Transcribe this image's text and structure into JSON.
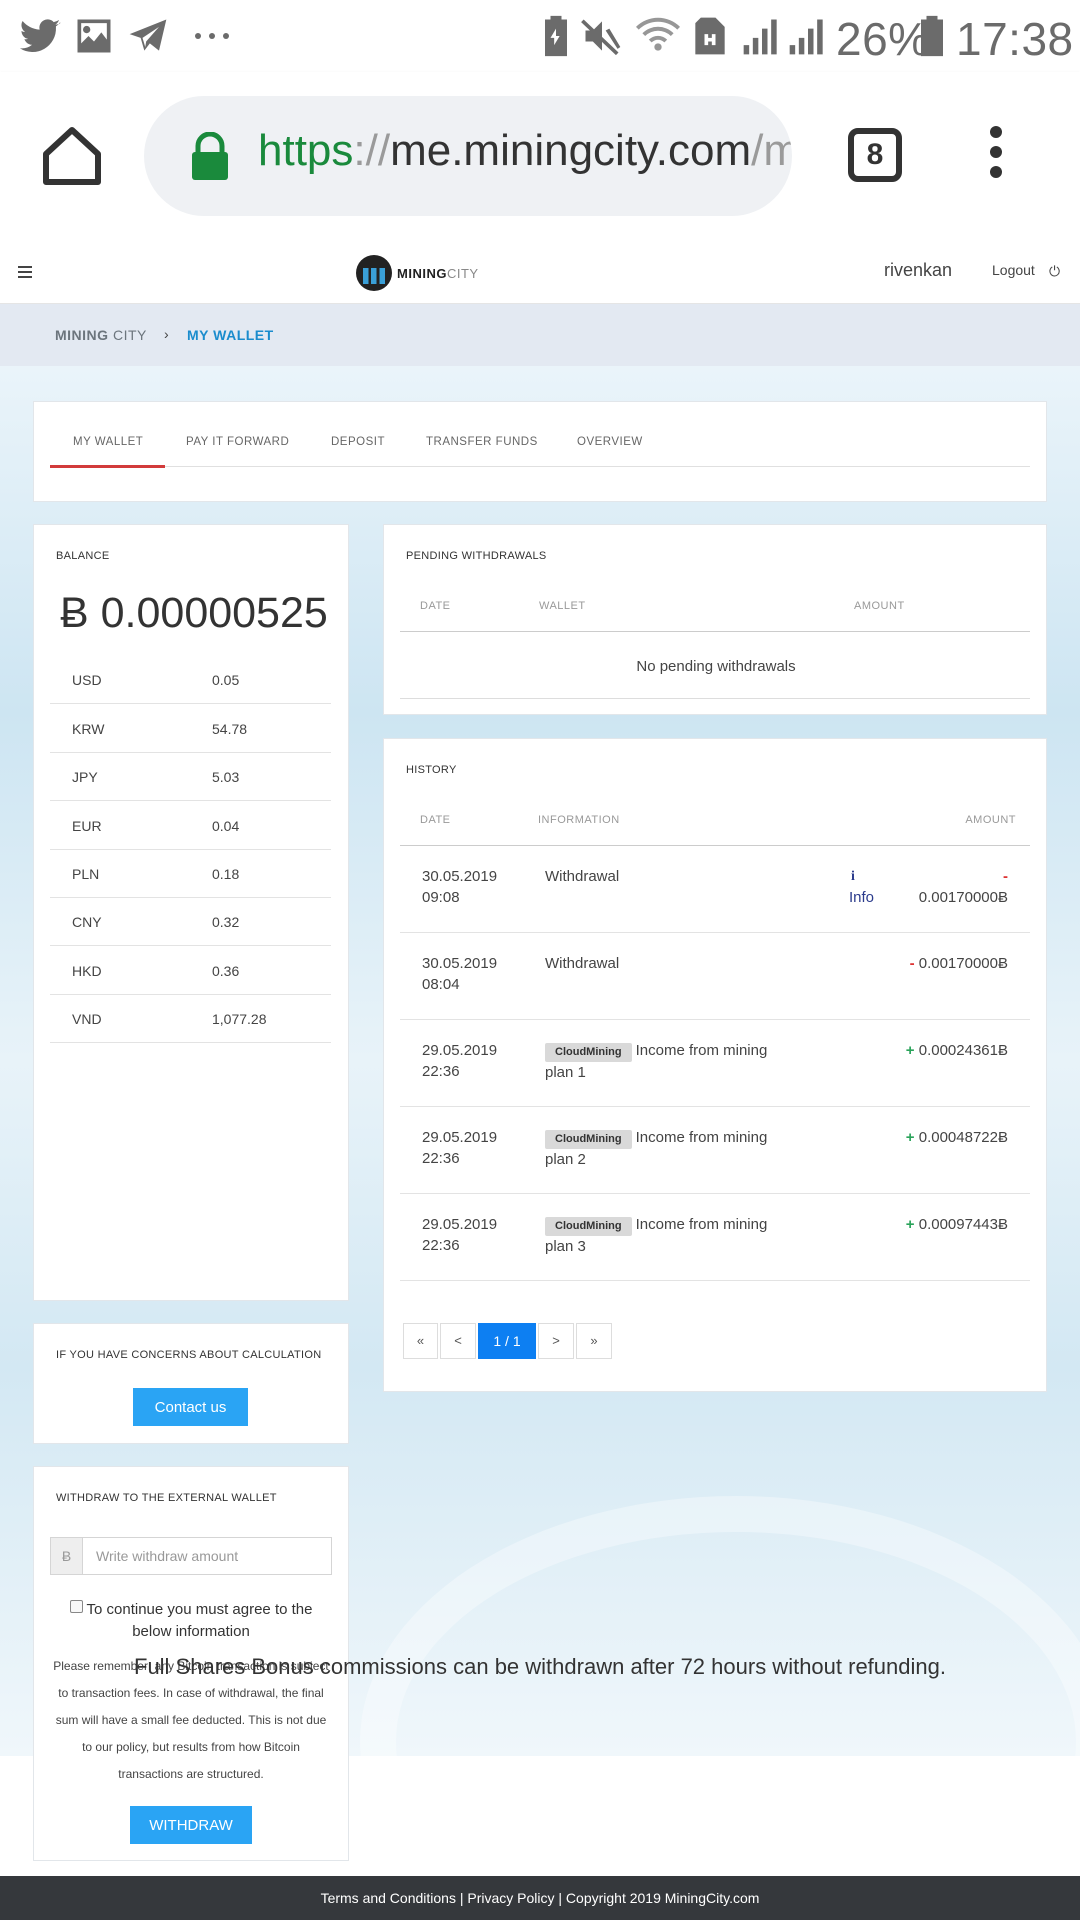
{
  "status_bar": {
    "battery_percent": "26%",
    "time": "17:38",
    "left_icons": [
      "twitter-icon",
      "image-icon",
      "telegram-icon",
      "more-notifications-icon"
    ],
    "right_icons": [
      "battery-saver-icon",
      "mute-icon",
      "wifi-icon",
      "sim-icon",
      "signal-icon",
      "signal-icon",
      "battery-icon"
    ]
  },
  "browser": {
    "url_scheme": "https",
    "url_sep": "://",
    "url_host": "me.miningcity.com",
    "url_rest": "/my",
    "tab_count": "8"
  },
  "header": {
    "logo_mining": "MINING",
    "logo_city": "CITY",
    "username": "rivenkan",
    "logout_label": "Logout"
  },
  "breadcrumb": {
    "root_bold": "MINING",
    "root_light": "CITY",
    "separator": "›",
    "current": "MY WALLET"
  },
  "tabs": [
    {
      "label": "MY WALLET",
      "active": true
    },
    {
      "label": "PAY IT FORWARD",
      "active": false
    },
    {
      "label": "DEPOSIT",
      "active": false
    },
    {
      "label": "TRANSFER FUNDS",
      "active": false
    },
    {
      "label": "OVERVIEW",
      "active": false
    }
  ],
  "balance": {
    "title": "BALANCE",
    "value": "Ƀ 0.00000525",
    "currencies": [
      {
        "code": "USD",
        "value": "0.05"
      },
      {
        "code": "KRW",
        "value": "54.78"
      },
      {
        "code": "JPY",
        "value": "5.03"
      },
      {
        "code": "EUR",
        "value": "0.04"
      },
      {
        "code": "PLN",
        "value": "0.18"
      },
      {
        "code": "CNY",
        "value": "0.32"
      },
      {
        "code": "HKD",
        "value": "0.36"
      },
      {
        "code": "VND",
        "value": "1,077.28"
      }
    ]
  },
  "concerns": {
    "title": "IF YOU HAVE CONCERNS ABOUT CALCULATION",
    "button": "Contact us"
  },
  "withdraw": {
    "title": "WITHDRAW TO THE EXTERNAL WALLET",
    "addon": "Ƀ",
    "placeholder": "Write withdraw amount",
    "agree": "To continue you must agree to the below information",
    "note": "Please remember: any Bitcoin transaction is subject to transaction fees. In case of withdrawal, the final sum will have a small fee deducted. This is not due to our policy, but results from how Bitcoin transactions are structured.",
    "button": "WITHDRAW"
  },
  "pending": {
    "title": "PENDING WITHDRAWALS",
    "col_date": "DATE",
    "col_wallet": "WALLET",
    "col_amount": "AMOUNT",
    "empty": "No pending withdrawals"
  },
  "history": {
    "title": "HISTORY",
    "col_date": "DATE",
    "col_info": "INFORMATION",
    "col_amount": "AMOUNT",
    "info_link": "Info",
    "rows": [
      {
        "date": "30.05.2019",
        "time": "09:08",
        "badge": "",
        "info": "Withdrawal",
        "sign": "-",
        "amount": "0.00170000Ƀ",
        "has_info_link": true
      },
      {
        "date": "30.05.2019",
        "time": "08:04",
        "badge": "",
        "info": "Withdrawal",
        "sign": "-",
        "amount": "0.00170000Ƀ",
        "has_info_link": false
      },
      {
        "date": "29.05.2019",
        "time": "22:36",
        "badge": "CloudMining",
        "info": "Income from mining plan 1",
        "sign": "+",
        "amount": "0.00024361Ƀ",
        "has_info_link": false
      },
      {
        "date": "29.05.2019",
        "time": "22:36",
        "badge": "CloudMining",
        "info": "Income from mining plan 2",
        "sign": "+",
        "amount": "0.00048722Ƀ",
        "has_info_link": false
      },
      {
        "date": "29.05.2019",
        "time": "22:36",
        "badge": "CloudMining",
        "info": "Income from mining plan 3",
        "sign": "+",
        "amount": "0.00097443Ƀ",
        "has_info_link": false
      }
    ],
    "pager": {
      "first": "«",
      "prev": "<",
      "current": "1 / 1",
      "next": ">",
      "last": "»"
    }
  },
  "bonus_notice": "Full Shares Bonus commissions can be withdrawn after 72 hours without refunding.",
  "footer": "Terms and Conditions | Privacy Policy | Copyright 2019 MiningCity.com",
  "colors": {
    "accent_blue": "#2aa4f4",
    "tab_active_red": "#d23b3b",
    "pager_active": "#0d7ff2",
    "positive": "#2aa35a",
    "negative": "#dd3333",
    "footer_bg": "#35383c"
  }
}
